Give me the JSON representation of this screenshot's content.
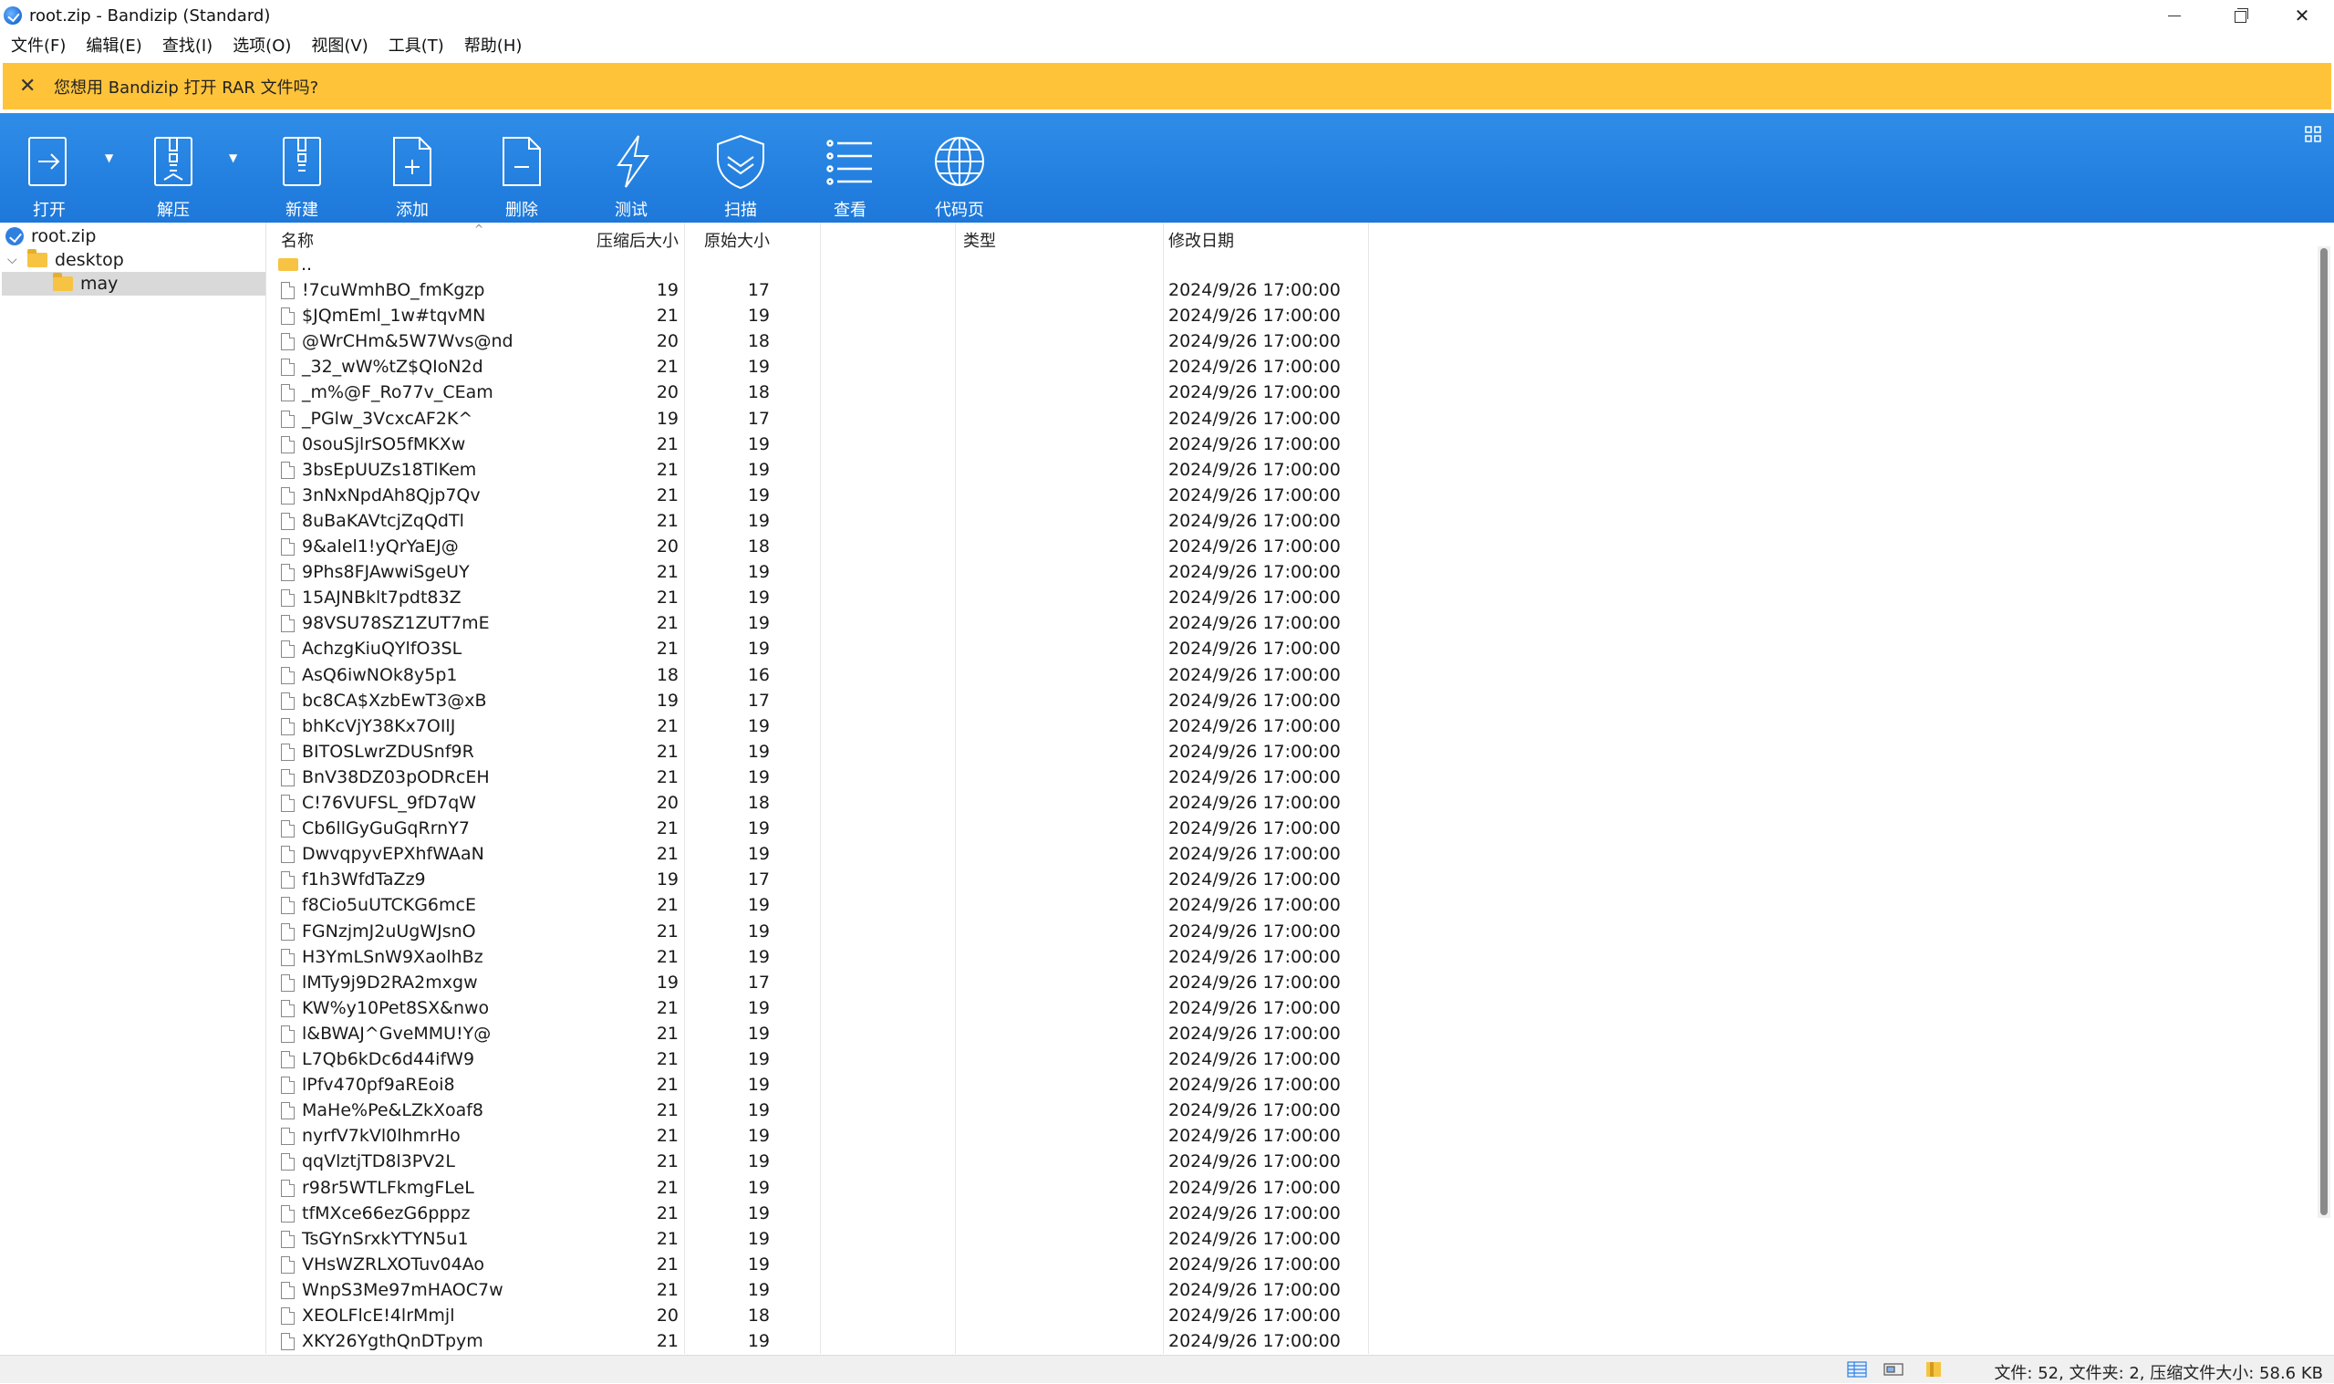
{
  "window": {
    "title": "root.zip - Bandizip (Standard)"
  },
  "menu": [
    "文件(F)",
    "编辑(E)",
    "查找(I)",
    "选项(O)",
    "视图(V)",
    "工具(T)",
    "帮助(H)"
  ],
  "notification": {
    "text": "您想用 Bandizip 打开 RAR 文件吗?",
    "bg_color": "#ffc33a"
  },
  "toolbar": {
    "accent_color": "#1d78da",
    "buttons": [
      {
        "label": "打开",
        "icon": "open-icon"
      },
      {
        "label": "解压",
        "icon": "extract-icon"
      },
      {
        "label": "新建",
        "icon": "new-archive-icon"
      },
      {
        "label": "添加",
        "icon": "add-file-icon"
      },
      {
        "label": "删除",
        "icon": "delete-file-icon"
      },
      {
        "label": "测试",
        "icon": "test-icon"
      },
      {
        "label": "扫描",
        "icon": "scan-shield-icon"
      },
      {
        "label": "查看",
        "icon": "view-list-icon"
      },
      {
        "label": "代码页",
        "icon": "globe-icon"
      }
    ]
  },
  "tree": {
    "root": "root.zip",
    "folder": "desktop",
    "subfolder": "may"
  },
  "columns": {
    "name": "名称",
    "packed": "压缩后大小",
    "size": "原始大小",
    "type": "类型",
    "modified": "修改日期"
  },
  "parent_dir": "..",
  "files": [
    {
      "name": "!7cuWmhBO_fmKgzp",
      "packed": "19",
      "size": "17",
      "date": "2024/9/26 17:00:00"
    },
    {
      "name": "$JQmEml_1w#tqvMN",
      "packed": "21",
      "size": "19",
      "date": "2024/9/26 17:00:00"
    },
    {
      "name": "@WrCHm&5W7Wvs@nd",
      "packed": "20",
      "size": "18",
      "date": "2024/9/26 17:00:00"
    },
    {
      "name": "_32_wW%tZ$QIoN2d",
      "packed": "21",
      "size": "19",
      "date": "2024/9/26 17:00:00"
    },
    {
      "name": "_m%@F_Ro77v_CEam",
      "packed": "20",
      "size": "18",
      "date": "2024/9/26 17:00:00"
    },
    {
      "name": "_PGlw_3VcxcAF2K^",
      "packed": "19",
      "size": "17",
      "date": "2024/9/26 17:00:00"
    },
    {
      "name": "0souSjlrSO5fMKXw",
      "packed": "21",
      "size": "19",
      "date": "2024/9/26 17:00:00"
    },
    {
      "name": "3bsEpUUZs18TlKem",
      "packed": "21",
      "size": "19",
      "date": "2024/9/26 17:00:00"
    },
    {
      "name": "3nNxNpdAh8Qjp7Qv",
      "packed": "21",
      "size": "19",
      "date": "2024/9/26 17:00:00"
    },
    {
      "name": "8uBaKAVtcjZqQdTl",
      "packed": "21",
      "size": "19",
      "date": "2024/9/26 17:00:00"
    },
    {
      "name": "9&alel1!yQrYaEJ@",
      "packed": "20",
      "size": "18",
      "date": "2024/9/26 17:00:00"
    },
    {
      "name": "9Phs8FJAwwiSgeUY",
      "packed": "21",
      "size": "19",
      "date": "2024/9/26 17:00:00"
    },
    {
      "name": "15AJNBklt7pdt83Z",
      "packed": "21",
      "size": "19",
      "date": "2024/9/26 17:00:00"
    },
    {
      "name": "98VSU78SZ1ZUT7mE",
      "packed": "21",
      "size": "19",
      "date": "2024/9/26 17:00:00"
    },
    {
      "name": "AchzgKiuQYlfO3SL",
      "packed": "21",
      "size": "19",
      "date": "2024/9/26 17:00:00"
    },
    {
      "name": "AsQ6iwNOk8y5p1",
      "packed": "18",
      "size": "16",
      "date": "2024/9/26 17:00:00"
    },
    {
      "name": "bc8CA$XzbEwT3@xB",
      "packed": "19",
      "size": "17",
      "date": "2024/9/26 17:00:00"
    },
    {
      "name": "bhKcVjY38Kx7OIlJ",
      "packed": "21",
      "size": "19",
      "date": "2024/9/26 17:00:00"
    },
    {
      "name": "BITOSLwrZDUSnf9R",
      "packed": "21",
      "size": "19",
      "date": "2024/9/26 17:00:00"
    },
    {
      "name": "BnV38DZ03pODRcEH",
      "packed": "21",
      "size": "19",
      "date": "2024/9/26 17:00:00"
    },
    {
      "name": "C!76VUFSL_9fD7qW",
      "packed": "20",
      "size": "18",
      "date": "2024/9/26 17:00:00"
    },
    {
      "name": "Cb6llGyGuGqRrnY7",
      "packed": "21",
      "size": "19",
      "date": "2024/9/26 17:00:00"
    },
    {
      "name": "DwvqpyvEPXhfWAaN",
      "packed": "21",
      "size": "19",
      "date": "2024/9/26 17:00:00"
    },
    {
      "name": "f1h3WfdTaZz9",
      "packed": "19",
      "size": "17",
      "date": "2024/9/26 17:00:00"
    },
    {
      "name": "f8Cio5uUTCKG6mcE",
      "packed": "21",
      "size": "19",
      "date": "2024/9/26 17:00:00"
    },
    {
      "name": "FGNzjmJ2uUgWJsnO",
      "packed": "21",
      "size": "19",
      "date": "2024/9/26 17:00:00"
    },
    {
      "name": "H3YmLSnW9XaolhBz",
      "packed": "21",
      "size": "19",
      "date": "2024/9/26 17:00:00"
    },
    {
      "name": "lMTy9j9D2RA2mxgw",
      "packed": "19",
      "size": "17",
      "date": "2024/9/26 17:00:00"
    },
    {
      "name": "KW%y10Pet8SX&nwo",
      "packed": "21",
      "size": "19",
      "date": "2024/9/26 17:00:00"
    },
    {
      "name": "l&BWAJ^GveMMU!Y@",
      "packed": "21",
      "size": "19",
      "date": "2024/9/26 17:00:00"
    },
    {
      "name": "L7Qb6kDc6d44ifW9",
      "packed": "21",
      "size": "19",
      "date": "2024/9/26 17:00:00"
    },
    {
      "name": "lPfv470pf9aREoi8",
      "packed": "21",
      "size": "19",
      "date": "2024/9/26 17:00:00"
    },
    {
      "name": "MaHe%Pe&LZkXoaf8",
      "packed": "21",
      "size": "19",
      "date": "2024/9/26 17:00:00"
    },
    {
      "name": "nyrfV7kVl0lhmrHo",
      "packed": "21",
      "size": "19",
      "date": "2024/9/26 17:00:00"
    },
    {
      "name": "qqVlztjTD8l3PV2L",
      "packed": "21",
      "size": "19",
      "date": "2024/9/26 17:00:00"
    },
    {
      "name": "r98r5WTLFkmgFLeL",
      "packed": "21",
      "size": "19",
      "date": "2024/9/26 17:00:00"
    },
    {
      "name": "tfMXce66ezG6pppz",
      "packed": "21",
      "size": "19",
      "date": "2024/9/26 17:00:00"
    },
    {
      "name": "TsGYnSrxkYTYN5u1",
      "packed": "21",
      "size": "19",
      "date": "2024/9/26 17:00:00"
    },
    {
      "name": "VHsWZRLXOTuv04Ao",
      "packed": "21",
      "size": "19",
      "date": "2024/9/26 17:00:00"
    },
    {
      "name": "WnpS3Me97mHAOC7w",
      "packed": "21",
      "size": "19",
      "date": "2024/9/26 17:00:00"
    },
    {
      "name": "XEOLFlcE!4lrMmjl",
      "packed": "20",
      "size": "18",
      "date": "2024/9/26 17:00:00"
    },
    {
      "name": "XKY26YgthQnDTpym",
      "packed": "21",
      "size": "19",
      "date": "2024/9/26 17:00:00"
    }
  ],
  "status": {
    "text": "文件: 52, 文件夹: 2, 压缩文件大小: 58.6 KB"
  }
}
